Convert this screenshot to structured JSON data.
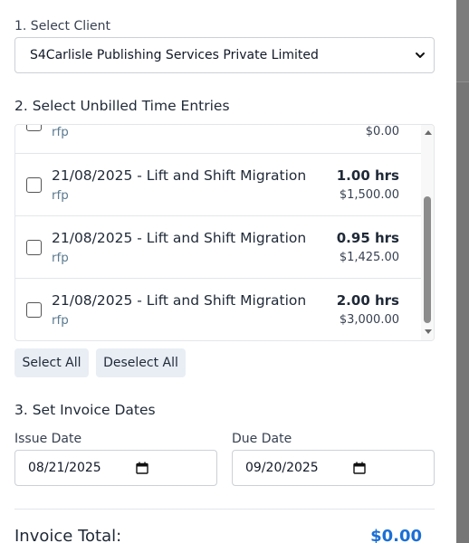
{
  "client": {
    "heading": "1. Select Client",
    "selected": "S4Carlisle Publishing Services Private Limited"
  },
  "entries": {
    "heading": "2. Select Unbilled Time Entries",
    "partial_row": {
      "subtitle": "rfp",
      "amount": "$0.00"
    },
    "rows": [
      {
        "title": "21/08/2025 - Lift and Shift Migration",
        "subtitle": "rfp",
        "hours": "1.00 hrs",
        "amount": "$1,500.00"
      },
      {
        "title": "21/08/2025 - Lift and Shift Migration",
        "subtitle": "rfp",
        "hours": "0.95 hrs",
        "amount": "$1,425.00"
      },
      {
        "title": "21/08/2025 - Lift and Shift Migration",
        "subtitle": "rfp",
        "hours": "2.00 hrs",
        "amount": "$3,000.00"
      }
    ],
    "select_all_label": "Select All",
    "deselect_all_label": "Deselect All"
  },
  "dates": {
    "heading": "3. Set Invoice Dates",
    "issue_label": "Issue Date",
    "issue_value": "08/21/2025",
    "due_label": "Due Date",
    "due_value": "09/20/2025"
  },
  "total": {
    "label": "Invoice Total:",
    "value": "$0.00"
  },
  "colors": {
    "accent": "#1a6fd6",
    "subtitle": "#5b7a90",
    "button_bg": "#e9eef5"
  }
}
